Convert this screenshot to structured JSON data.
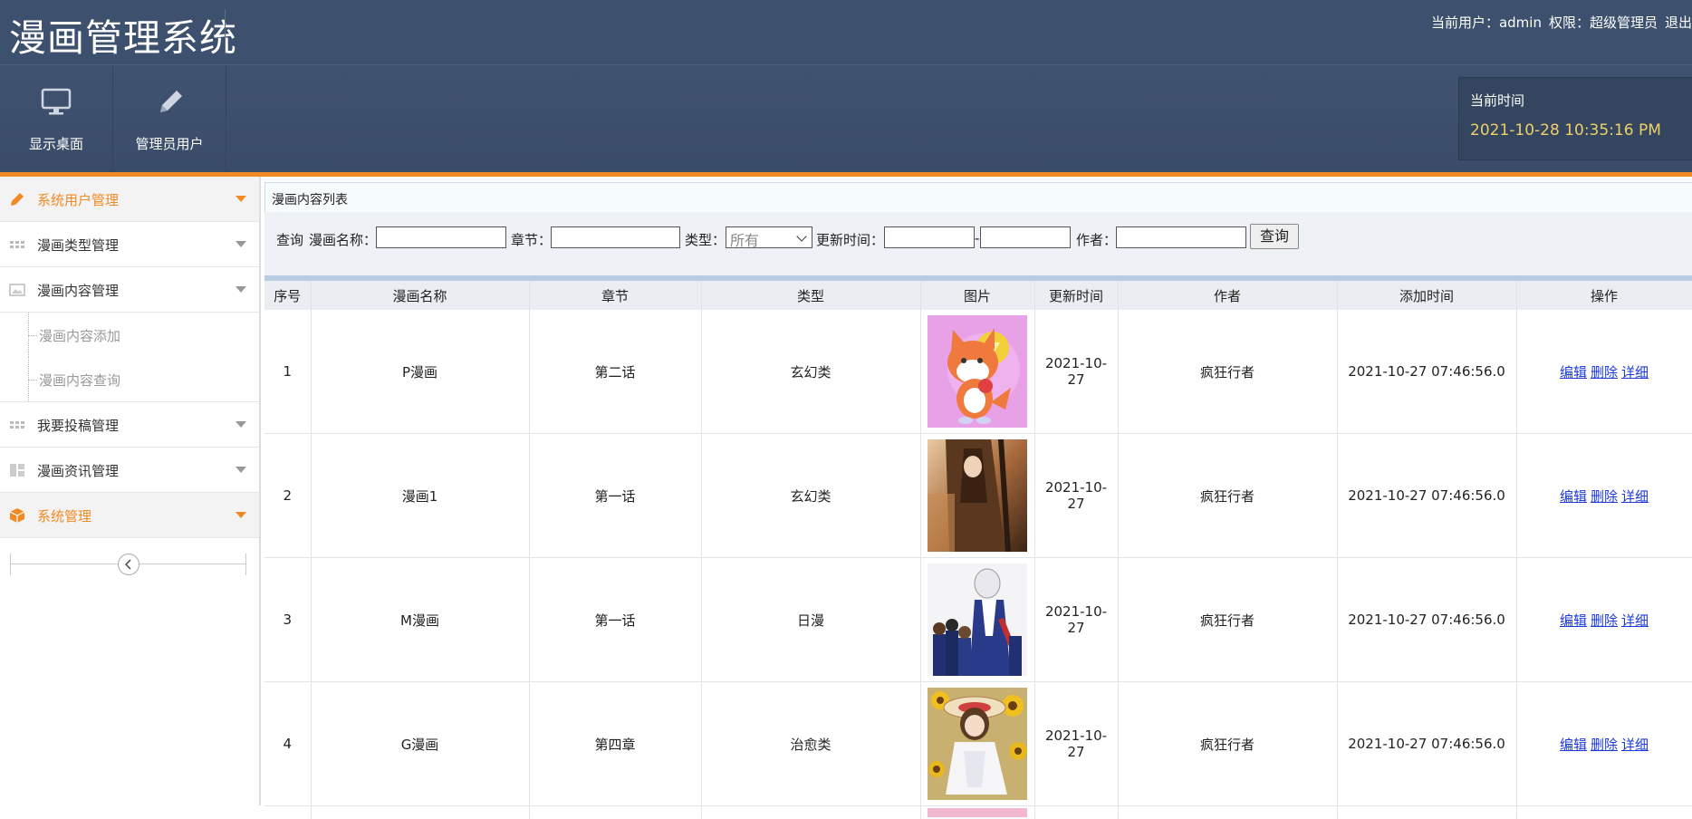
{
  "header": {
    "title": "漫画管理系统",
    "current_user_label": "当前用户：admin",
    "role_label": "权限：超级管理员",
    "logout_label": "退出"
  },
  "toolbar": {
    "items": [
      {
        "label": "显示桌面",
        "icon": "monitor-icon"
      },
      {
        "label": "管理员用户",
        "icon": "pencil-icon"
      }
    ],
    "clock_label": "当前时间",
    "clock_value": "2021-10-28 10:35:16 PM"
  },
  "sidebar": {
    "items": [
      {
        "label": "系统用户管理",
        "icon": "pencil-icon",
        "active": true
      },
      {
        "label": "漫画类型管理",
        "icon": "grid-icon"
      },
      {
        "label": "漫画内容管理",
        "icon": "picture-icon"
      },
      {
        "label": "漫画内容添加",
        "sub": true
      },
      {
        "label": "漫画内容查询",
        "sub": true
      },
      {
        "label": "我要投稿管理",
        "icon": "grid-icon"
      },
      {
        "label": "漫画资讯管理",
        "icon": "layout-icon"
      },
      {
        "label": "系统管理",
        "icon": "box-icon",
        "active": true
      }
    ]
  },
  "panel": {
    "title": "漫画内容列表",
    "filter": {
      "query_label": "查询",
      "name_label": "漫画名称：",
      "chapter_label": "章节：",
      "type_label": "类型：",
      "type_value": "所有",
      "update_time_label": "更新时间：",
      "range_sep": "-",
      "author_label": "作者：",
      "search_button": "查询"
    }
  },
  "table": {
    "columns": [
      "序号",
      "漫画名称",
      "章节",
      "类型",
      "图片",
      "更新时间",
      "作者",
      "添加时间",
      "操作"
    ],
    "rows": [
      {
        "no": "1",
        "name": "P漫画",
        "chapter": "第二话",
        "type": "玄幻类",
        "image": "fox-mascot-image",
        "update_time_1": "2021-10-",
        "update_time_2": "27",
        "author": "疯狂行者",
        "added": "2021-10-27 07:46:56.0"
      },
      {
        "no": "2",
        "name": "漫画1",
        "chapter": "第一话",
        "type": "玄幻类",
        "image": "anime-girl-image",
        "update_time_1": "2021-10-",
        "update_time_2": "27",
        "author": "疯狂行者",
        "added": "2021-10-27 07:46:56.0"
      },
      {
        "no": "3",
        "name": "M漫画",
        "chapter": "第一话",
        "type": "日漫",
        "image": "tennis-team-image",
        "update_time_1": "2021-10-",
        "update_time_2": "27",
        "author": "疯狂行者",
        "added": "2021-10-27 07:46:56.0"
      },
      {
        "no": "4",
        "name": "G漫画",
        "chapter": "第四章",
        "type": "治愈类",
        "image": "sunflower-girl-image",
        "update_time_1": "2021-10-",
        "update_time_2": "27",
        "author": "疯狂行者",
        "added": "2021-10-27 07:46:56.0"
      }
    ],
    "actions": {
      "edit": "编辑",
      "delete": "删除",
      "detail": "详细"
    }
  },
  "colors": {
    "header": "#3d506e",
    "accent": "#f08a24",
    "link": "#1e3ad8"
  }
}
